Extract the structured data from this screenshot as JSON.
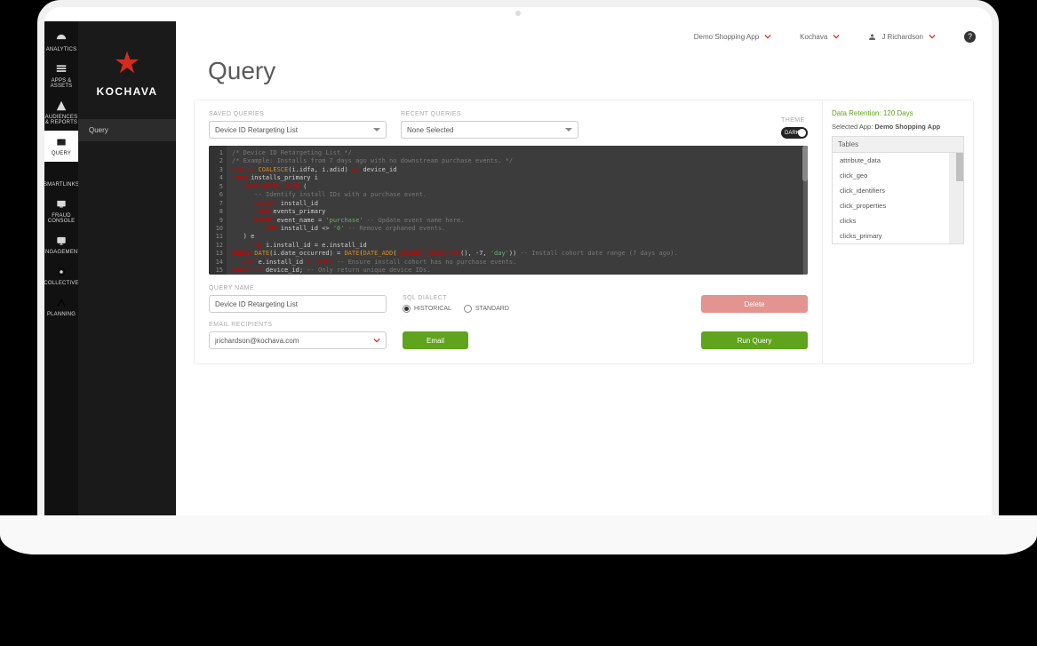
{
  "rail": {
    "items": [
      {
        "id": "analytics",
        "label": "ANALYTICS"
      },
      {
        "id": "apps",
        "label": "APPS & ASSETS"
      },
      {
        "id": "audiences",
        "label": "AUDIENCES & REPORTS"
      },
      {
        "id": "query",
        "label": "QUERY"
      },
      {
        "id": "smartlinks",
        "label": "SMARTLINKS"
      },
      {
        "id": "fraud",
        "label": "FRAUD CONSOLE"
      },
      {
        "id": "engagement",
        "label": "ENGAGEMENT"
      },
      {
        "id": "collective",
        "label": "COLLECTIVE"
      },
      {
        "id": "planning",
        "label": "PLANNING"
      }
    ],
    "active": "query"
  },
  "brand": {
    "name": "KOCHAVA"
  },
  "sidebar": {
    "items": [
      {
        "label": "Query"
      }
    ]
  },
  "topbar": {
    "app": "Demo Shopping App",
    "org": "Kochava",
    "user": "J Richardson"
  },
  "page_title": "Query",
  "labels": {
    "saved": "SAVED QUERIES",
    "recent": "RECENT QUERIES",
    "theme": "THEME",
    "query_name": "QUERY NAME",
    "sql_dialect": "SQL DIALECT",
    "email_recip": "EMAIL RECIPIENTS"
  },
  "dropdowns": {
    "saved": "Device ID Retargeting List",
    "recent": "None Selected"
  },
  "theme_toggle": "DARK",
  "code_lines": [
    {
      "n": 1,
      "html": "<span class='cmt'>/* Device ID Retargeting List */</span>"
    },
    {
      "n": 2,
      "html": "<span class='cmt'>/* Example: Installs from 7 days ago with no downstream purchase events. */</span>"
    },
    {
      "n": 3,
      "html": "<span class='kw-red'>SELECT</span> <span class='kw-orange'>COALESCE</span>(i.idfa, i.adid) <span class='kw-red'>AS</span> device_id"
    },
    {
      "n": 4,
      "html": "<span class='kw-red'>FROM</span> installs_primary i"
    },
    {
      "n": 5,
      "html": "   <span class='kw-red'>LEFT OUTER JOIN</span> ("
    },
    {
      "n": 6,
      "html": "      <span class='cmt'>-- Identify install IDs with a purchase event.</span>"
    },
    {
      "n": 7,
      "html": "      <span class='kw-red'>SELECT</span> install_id"
    },
    {
      "n": 8,
      "html": "      <span class='kw-red'>FROM</span> events_primary"
    },
    {
      "n": 9,
      "html": "      <span class='kw-red'>WHERE</span> event_name = <span class='kw-green'>'purchase'</span> <span class='cmt'>-- Update event name here.</span>"
    },
    {
      "n": 10,
      "html": "         <span class='kw-red'>AND</span> install_id &lt;&gt; <span class='kw-green'>'0'</span> <span class='cmt'>-- Remove orphaned events.</span>"
    },
    {
      "n": 11,
      "html": "   ) e"
    },
    {
      "n": 12,
      "html": "      <span class='kw-red'>ON</span> i.install_id = e.install_id"
    },
    {
      "n": 13,
      "html": "<span class='kw-red'>WHERE</span> <span class='kw-orange'>DATE</span>(i.date_occurred) = <span class='kw-orange'>DATE</span>(<span class='kw-orange'>DATE_ADD</span>(<span class='kw-red'>CURRENT_TIMESTAMP</span>(), -7, <span class='kw-green'>'day'</span>)) <span class='cmt'>-- Install cohort date range (7 days ago).</span>"
    },
    {
      "n": 14,
      "html": "   <span class='kw-red'>AND</span> e.install_id <span class='kw-red'>IS NULL</span> <span class='cmt'>-- Ensure install cohort has no purchase events.</span>"
    },
    {
      "n": 15,
      "html": "<span class='kw-red'>GROUP BY</span> device_id; <span class='cmt'>-- Only return unique device IDs.</span>"
    }
  ],
  "query_name": "Device ID Retargeting List",
  "dialect": {
    "options": [
      "HISTORICAL",
      "STANDARD"
    ],
    "selected": "HISTORICAL"
  },
  "buttons": {
    "delete": "Delete",
    "email": "Email",
    "run": "Run Query"
  },
  "email": "jrichardson@kochava.com",
  "side": {
    "retention": "Data Retention: 120 Days",
    "selected_app_label": "Selected App: ",
    "selected_app": "Demo Shopping App",
    "tables_header": "Tables",
    "tables": [
      "attribute_data",
      "click_geo",
      "click_identifiers",
      "click_properties",
      "clicks",
      "clicks_primary"
    ]
  }
}
